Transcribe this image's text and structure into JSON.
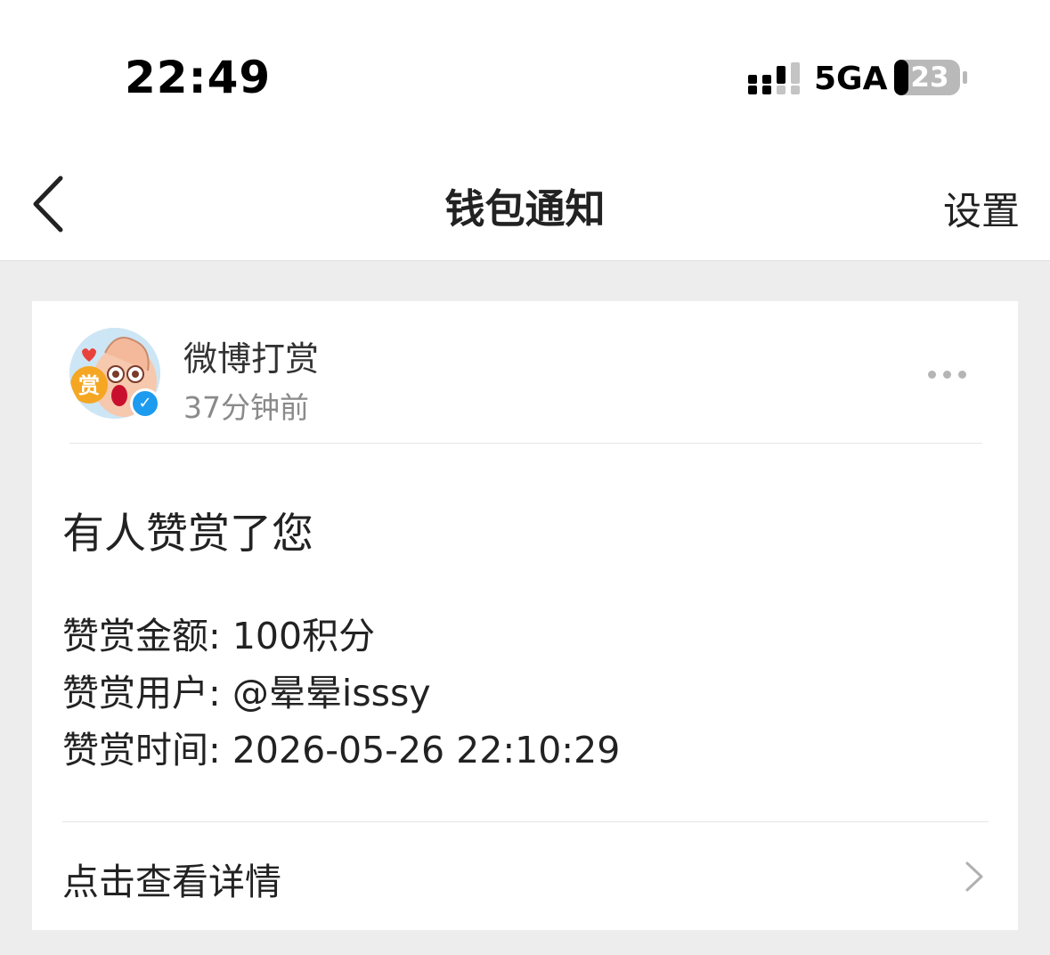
{
  "status_bar": {
    "time": "22:49",
    "network": "5GA",
    "battery": "23"
  },
  "nav": {
    "title": "钱包通知",
    "right_action": "设置"
  },
  "notification": {
    "sender": "微博打赏",
    "time_ago": "37分钟前",
    "avatar_badge": "赏",
    "headline": "有人赞赏了您",
    "details": [
      "赞赏金额: 100积分",
      "赞赏用户: @晕晕isssy",
      "赞赏时间: 2026-05-26 22:10:29"
    ],
    "link_label": "点击查看详情"
  },
  "colors": {
    "verified_badge": "#1c9bef",
    "avatar_badge": "#f5a623",
    "page_background": "#ededed"
  }
}
